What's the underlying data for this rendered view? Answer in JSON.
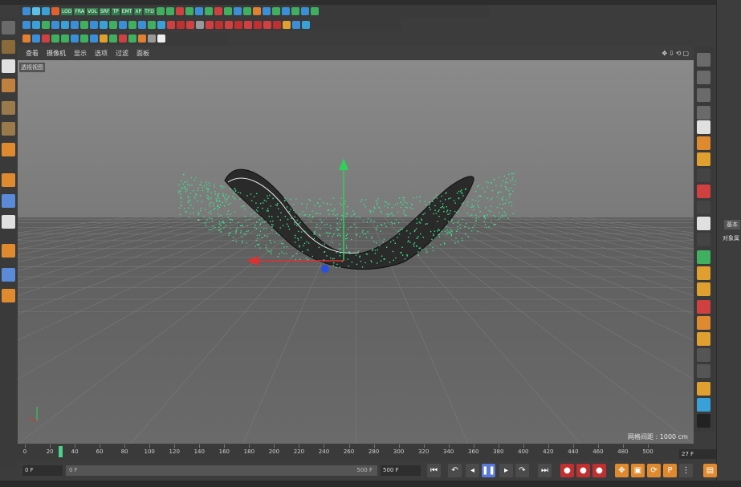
{
  "viewport": {
    "menu": [
      "查看",
      "摄像机",
      "显示",
      "选项",
      "过滤",
      "面板"
    ],
    "label": "透视视图",
    "grid_spacing": "网格间距 : 1000 cm"
  },
  "toolbar": {
    "render_tags": [
      "LOD",
      "FRA",
      "VOL",
      "SRF",
      "TP",
      "EMT",
      "XP",
      "TFD"
    ]
  },
  "timeline": {
    "ticks": [
      "0",
      "20",
      "40",
      "60",
      "80",
      "100",
      "120",
      "140",
      "160",
      "180",
      "200",
      "220",
      "240",
      "260",
      "280",
      "300",
      "320",
      "340",
      "360",
      "380",
      "400",
      "420",
      "440",
      "460",
      "480",
      "500"
    ],
    "current_frame": "27 F"
  },
  "playback": {
    "start_field": "0 F",
    "slider_start": "0 F",
    "slider_end": "500 F",
    "end_field": "500 F"
  },
  "attribute_panel": {
    "tab": "基本",
    "label": "对象属"
  },
  "colors": {
    "particles": "#3de08a",
    "axis_y": "#2fd05a",
    "axis_x": "#e03030",
    "axis_z": "#2a4ee0",
    "playhead": "#4ad08a"
  }
}
